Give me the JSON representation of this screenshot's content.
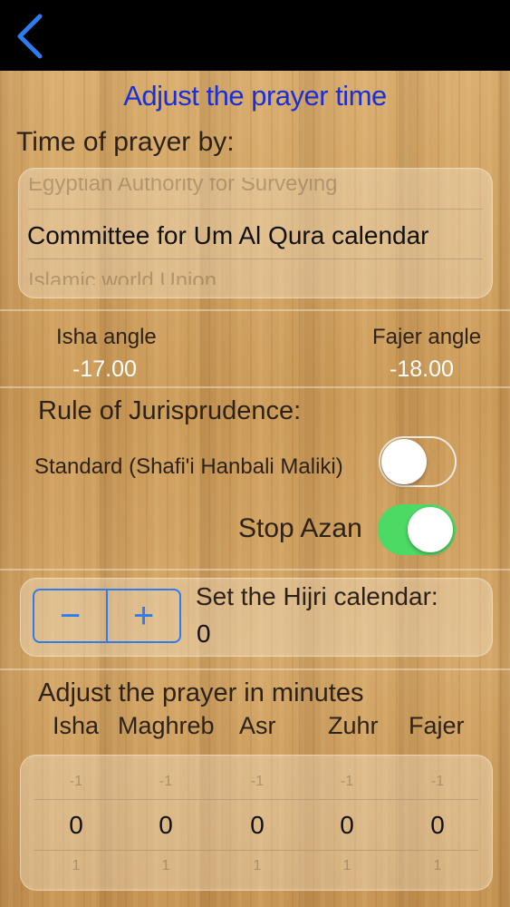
{
  "nav": {
    "back_icon": "chevron-left-icon"
  },
  "title": "Adjust the prayer time",
  "time_of_prayer": {
    "label": "Time of prayer by:",
    "options_above": "Egyptian Authority for Surveying",
    "selected": "Committee for Um Al Qura calendar",
    "options_below": "Islamic world Union"
  },
  "angles": {
    "isha_label": "Isha angle",
    "isha_value": "-17.00",
    "fajer_label": "Fajer angle",
    "fajer_value": "-18.00"
  },
  "jurisprudence": {
    "label": "Rule of Jurisprudence:",
    "standard_label": "Standard (Shafi'i Hanbali Maliki)",
    "standard_on": false
  },
  "stop_azan": {
    "label": "Stop Azan",
    "on": true
  },
  "hijri": {
    "minus": "−",
    "plus": "+",
    "label": "Set the Hijri calendar:",
    "value": "0"
  },
  "adjust_minutes": {
    "label": "Adjust the prayer in minutes",
    "columns": [
      {
        "name": "Isha",
        "above": "-1",
        "value": "0",
        "below": "1"
      },
      {
        "name": "Maghreb",
        "above": "-1",
        "value": "0",
        "below": "1"
      },
      {
        "name": "Asr",
        "above": "-1",
        "value": "0",
        "below": "1"
      },
      {
        "name": "Zuhr",
        "above": "-1",
        "value": "0",
        "below": "1"
      },
      {
        "name": "Fajer",
        "above": "-1",
        "value": "0",
        "below": "1"
      }
    ]
  },
  "colors": {
    "accent_blue": "#1a2fd6",
    "stepper_blue": "#2e7df0",
    "toggle_on": "#4cd964"
  }
}
